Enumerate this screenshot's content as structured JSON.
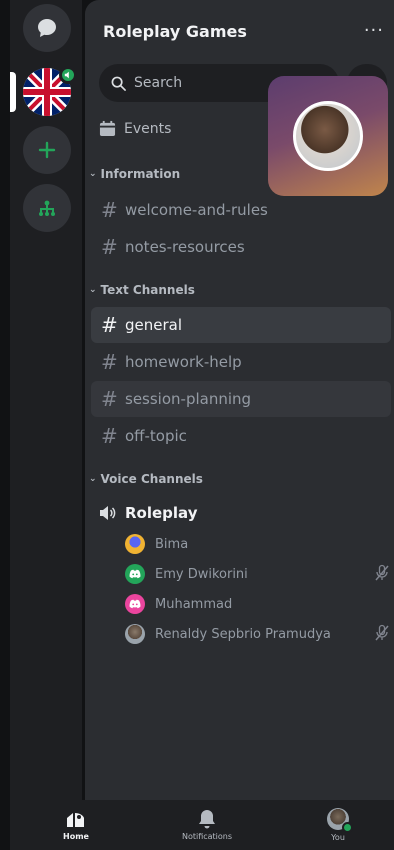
{
  "server": {
    "title": "Roleplay Games",
    "more_label": "···"
  },
  "search": {
    "placeholder": "Search"
  },
  "events": {
    "label": "Events"
  },
  "categories": {
    "information": "Information",
    "text": "Text Channels",
    "voice": "Voice Channels"
  },
  "info_channels": [
    "welcome-and-rules",
    "notes-resources"
  ],
  "text_channels": [
    "general",
    "homework-help",
    "session-planning",
    "off-topic"
  ],
  "active_channel": "general",
  "voice_channel": {
    "name": "Roleplay"
  },
  "voice_members": [
    {
      "name": "Bima",
      "muted": false
    },
    {
      "name": "Emy Dwikorini",
      "muted": true
    },
    {
      "name": "Muhammad",
      "muted": false
    },
    {
      "name": "Renaldy Sepbrio Pramudya",
      "muted": true
    }
  ],
  "bottom_nav": {
    "home": "Home",
    "notifications": "Notifications",
    "you": "You"
  },
  "colors": {
    "accent": "#23a55a",
    "discord_green": "#23a55a",
    "discord_pink": "#eb459e",
    "status_online": "#23a55a"
  }
}
